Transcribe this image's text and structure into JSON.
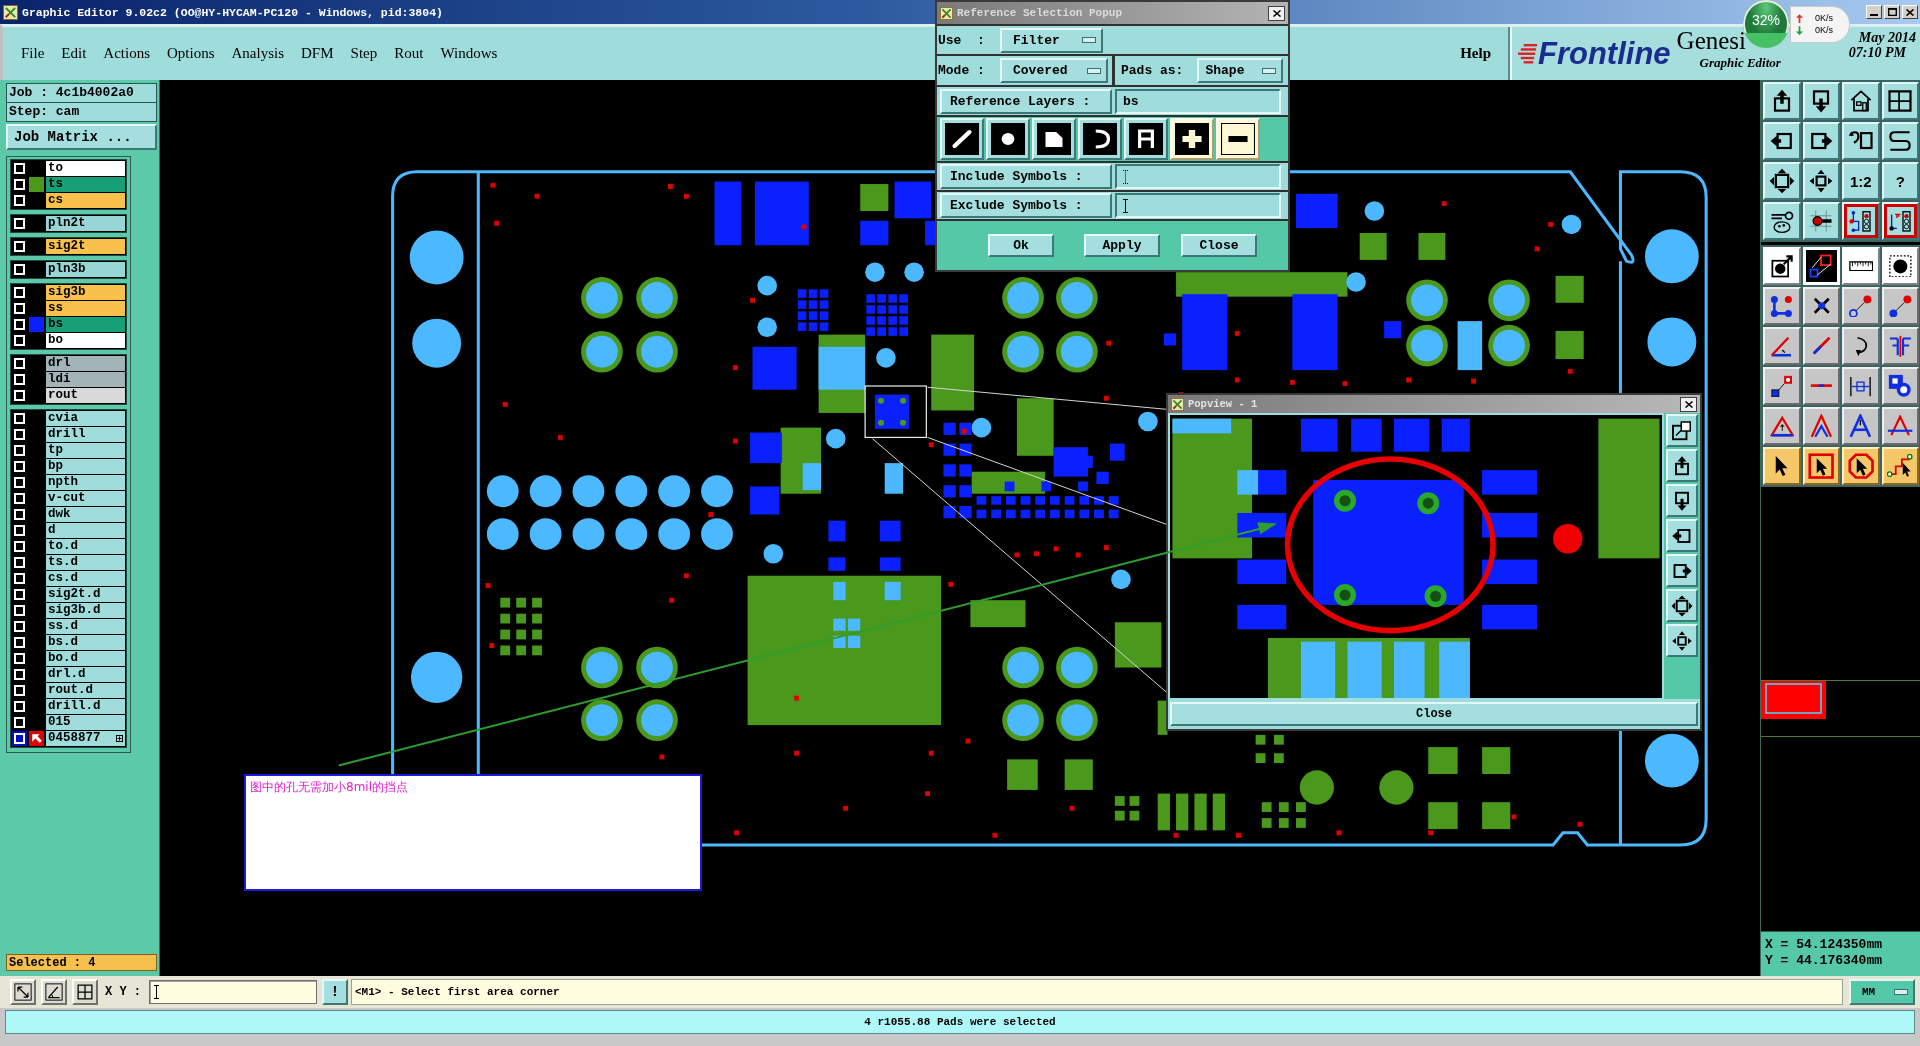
{
  "window": {
    "title": "Graphic Editor 9.02c2 (OO@HY-HYCAM-PC120 - Windows, pid:3804)"
  },
  "menu": [
    "File",
    "Edit",
    "Actions",
    "Options",
    "Analysis",
    "DFM",
    "Step",
    "Rout",
    "Windows"
  ],
  "help_menu": "Help",
  "brand": {
    "logo": "Frontline",
    "product": "Genesi",
    "subtitle": "Graphic Editor",
    "date": "May 2014",
    "time": "07:10 PM"
  },
  "network_monitor": {
    "load": "32%",
    "level": 0.32,
    "upload": "0K/s",
    "download": "0K/s"
  },
  "job_panel": {
    "job": "Job : 4c1b4002a0",
    "step": "Step: cam",
    "matrix_button": "Job Matrix ..."
  },
  "layer_groups": [
    {
      "layers": [
        {
          "name": "to",
          "kind": "silk",
          "work": false
        },
        {
          "name": "ts",
          "kind": "mask",
          "work": false,
          "color": "#4a981c"
        },
        {
          "name": "cs",
          "kind": "signal",
          "work": false
        }
      ]
    },
    {
      "layers": [
        {
          "name": "pln2t",
          "kind": "plane",
          "work": false
        }
      ]
    },
    {
      "layers": [
        {
          "name": "sig2t",
          "kind": "signal",
          "work": false
        }
      ]
    },
    {
      "layers": [
        {
          "name": "pln3b",
          "kind": "plane",
          "work": false
        }
      ]
    },
    {
      "layers": [
        {
          "name": "sig3b",
          "kind": "signal",
          "work": false
        },
        {
          "name": "ss",
          "kind": "signal",
          "work": false
        },
        {
          "name": "bs",
          "kind": "mask",
          "work": false,
          "color": "#0a20ff"
        },
        {
          "name": "bo",
          "kind": "silk",
          "work": false
        }
      ]
    },
    {
      "layers": [
        {
          "name": "drl",
          "kind": "drill",
          "work": false
        },
        {
          "name": "ldi",
          "kind": "drill",
          "work": false
        },
        {
          "name": "rout",
          "kind": "rout",
          "work": false
        }
      ]
    },
    {
      "layers": [
        {
          "name": "cvia",
          "kind": "misc",
          "work": false
        },
        {
          "name": "drill",
          "kind": "misc",
          "work": false
        },
        {
          "name": "tp",
          "kind": "misc",
          "work": false
        },
        {
          "name": "bp",
          "kind": "misc",
          "work": false
        },
        {
          "name": "npth",
          "kind": "misc",
          "work": false
        },
        {
          "name": "v-cut",
          "kind": "misc",
          "work": false
        },
        {
          "name": "dwk",
          "kind": "misc",
          "work": false
        },
        {
          "name": "d",
          "kind": "misc",
          "work": false
        },
        {
          "name": "to.d",
          "kind": "misc",
          "work": false
        },
        {
          "name": "ts.d",
          "kind": "misc",
          "work": false
        },
        {
          "name": "cs.d",
          "kind": "misc",
          "work": false
        },
        {
          "name": "sig2t.d",
          "kind": "misc",
          "work": false
        },
        {
          "name": "sig3b.d",
          "kind": "misc",
          "work": false
        },
        {
          "name": "ss.d",
          "kind": "misc",
          "work": false
        },
        {
          "name": "bs.d",
          "kind": "misc",
          "work": false
        },
        {
          "name": "bo.d",
          "kind": "misc",
          "work": false
        },
        {
          "name": "drl.d",
          "kind": "misc",
          "work": false
        },
        {
          "name": "rout.d",
          "kind": "misc",
          "work": false
        },
        {
          "name": "drill.d",
          "kind": "misc",
          "work": false
        },
        {
          "name": "015",
          "kind": "misc",
          "work": false
        },
        {
          "name": "0458877",
          "kind": "misc",
          "work": true
        }
      ]
    }
  ],
  "selected_count": "Selected : 4",
  "reference_popup": {
    "title": "Reference Selection Popup",
    "use": {
      "label": "Use  :",
      "value": "Filter"
    },
    "mode": {
      "label": "Mode :",
      "value": "Covered"
    },
    "pads_as": {
      "label": "Pads as:",
      "value": "Shape"
    },
    "reference_layers": {
      "button": "Reference Layers :",
      "value": "bs"
    },
    "feature_types": [
      {
        "selected": true
      },
      {
        "selected": true
      },
      {
        "selected": true
      },
      {
        "selected": true
      },
      {
        "selected": true
      }
    ],
    "polarity": [
      {
        "selected": true
      },
      {
        "selected": false
      }
    ],
    "include_symbols": {
      "button": "Include Symbols :"
    },
    "exclude_symbols": {
      "button": "Exclude Symbols :"
    },
    "buttons": [
      "Ok",
      "Apply",
      "Close"
    ]
  },
  "annotation": {
    "text": "图中的孔无需加小8mil的挡点"
  },
  "popview": {
    "title": "Popview - 1",
    "close_button": "Close"
  },
  "right_toolbar": [
    {
      "active": false
    },
    {
      "active": false
    },
    {
      "active": false
    },
    {
      "active": false
    },
    {
      "active": false
    },
    {
      "active": false
    },
    {
      "active": false
    },
    {
      "active": false
    },
    {
      "active": false
    },
    {
      "active": false
    },
    {
      "label": "1:2",
      "active": false
    },
    {
      "label": "?",
      "active": false
    },
    {
      "active": false
    },
    {
      "active": false
    },
    {
      "active": true
    },
    {
      "active": true
    },
    {
      "active": false
    },
    {
      "active": false
    },
    {
      "active": false
    },
    {
      "active": false
    },
    {
      "active": false
    },
    {
      "active": false
    },
    {
      "active": false
    },
    {
      "active": false
    },
    {
      "active": false
    },
    {
      "active": false
    },
    {
      "active": false
    },
    {
      "active": false
    },
    {
      "active": false
    },
    {
      "active": false
    },
    {
      "active": false
    },
    {
      "active": false
    },
    {
      "active": false
    },
    {
      "active": false
    },
    {
      "active": false
    },
    {
      "active": false
    },
    {
      "active": false
    },
    {
      "active": false
    },
    {
      "active": false
    },
    {
      "active": false
    }
  ],
  "coordinates": {
    "x": "X = 54.124350mm",
    "y": "Y = 44.176340mm"
  },
  "command_bar": {
    "xy_label": "X Y :",
    "alert_button": "!",
    "prompt": "<M1> - Select first area corner",
    "units": "MM"
  },
  "status_bar": {
    "message": "4 r1055.88 Pads were selected"
  }
}
